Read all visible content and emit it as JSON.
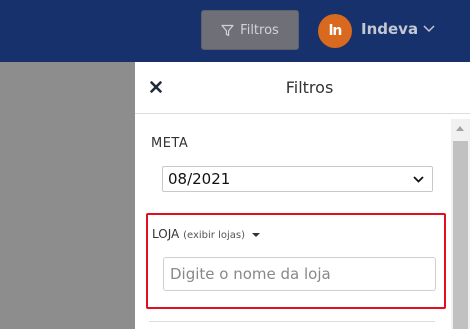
{
  "topbar": {
    "filter_button_label": "Filtros",
    "brand_name": "Indeva",
    "colors": {
      "background": "#16316b",
      "logo": "#d9691e"
    }
  },
  "panel": {
    "title": "Filtros",
    "meta": {
      "label": "META",
      "selected": "08/2021"
    },
    "loja": {
      "label": "LOJA",
      "toggle_label": "(exibir lojas)",
      "placeholder": "Digite o nome da loja",
      "value": ""
    },
    "highlight_color": "#e01020"
  },
  "icons": [
    "funnel-icon",
    "indeva-logo",
    "chevron-down-icon",
    "close-icon",
    "caret-down-icon",
    "scroll-up-icon"
  ]
}
